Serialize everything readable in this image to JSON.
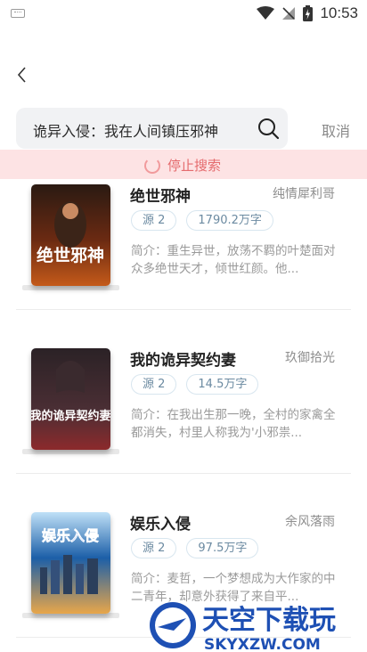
{
  "status_bar": {
    "time": "10:53"
  },
  "search": {
    "query": "诡异入侵：我在人间镇压邪神",
    "cancel_label": "取消"
  },
  "stop_search": {
    "label": "停止搜索"
  },
  "books": [
    {
      "title": "绝世邪神",
      "author": "纯情犀利哥",
      "source": "源 2",
      "words": "1790.2万字",
      "desc": "简介：重生异世，放荡不羁的叶楚面对众多绝世天才，倾世红颜。他...",
      "cover_text": "绝世邪神",
      "cover_colors": [
        "#2a1a12",
        "#c45a1a"
      ]
    },
    {
      "title": "我的诡异契约妻",
      "author": "玖御拾光",
      "source": "源 2",
      "words": "14.5万字",
      "desc": "简介：在我出生那一晚，全村的家禽全都消失，村里人称我为'小邪祟...",
      "cover_text": "我的诡异契约妻",
      "cover_colors": [
        "#2b2226",
        "#8c2a2c"
      ]
    },
    {
      "title": "娱乐入侵",
      "author": "余风落雨",
      "source": "源 2",
      "words": "97.5万字",
      "desc": "简介：麦哲，一个梦想成为大作家的中二青年，却意外获得了来自平...",
      "cover_text": "娱乐入侵",
      "cover_colors": [
        "#1c5fa8",
        "#e8a64a"
      ]
    }
  ],
  "watermark": {
    "brand_cn": "天空下载玩",
    "brand_en": "SKYXZW.COM"
  }
}
